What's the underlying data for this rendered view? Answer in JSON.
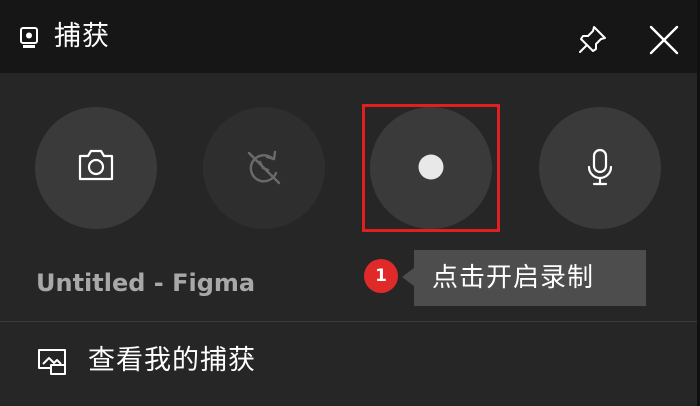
{
  "titlebar": {
    "title": "捕获",
    "icons": {
      "title": "webcam-icon",
      "pin": "pin-icon",
      "close": "close-icon"
    }
  },
  "capture_buttons": [
    {
      "action": "screenshot",
      "icon": "camera-icon",
      "enabled": true
    },
    {
      "action": "record-last-30-seconds",
      "icon": "replay-icon",
      "enabled": false
    },
    {
      "action": "start-recording",
      "icon": "record-dot-icon",
      "enabled": true
    },
    {
      "action": "microphone",
      "icon": "microphone-icon",
      "enabled": true
    }
  ],
  "capture_target": "Untitled - Figma",
  "annotation": {
    "step": "1",
    "tooltip": "点击开启录制",
    "highlight_color": "#e02020"
  },
  "footer": {
    "gallery_label": "查看我的捕获",
    "icon": "gallery-icon"
  },
  "colors": {
    "titlebar_bg": "#161616",
    "panel_bg": "#262626",
    "button_bg": "#3a3a3a",
    "badge_red": "#e02a2a",
    "tooltip_bg": "#4d4d4d"
  }
}
